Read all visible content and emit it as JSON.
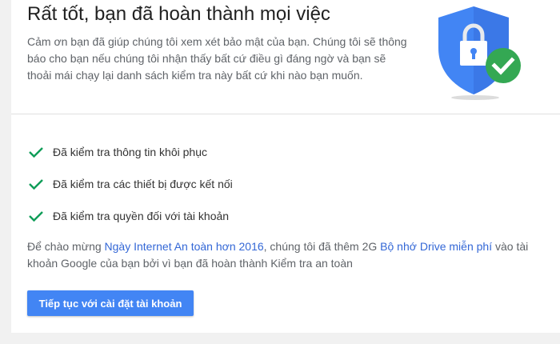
{
  "header": {
    "title": "Rất tốt, bạn đã hoàn thành mọi việc",
    "description": "Cảm ơn bạn đã giúp chúng tôi xem xét bảo mật của bạn. Chúng tôi sẽ thông báo cho bạn nếu chúng tôi nhận thấy bất cứ điều gì đáng ngờ và bạn sẽ thoải mái chạy lại danh sách kiểm tra này bất cứ khi nào bạn muốn."
  },
  "illustration": {
    "icon": "shield-lock-check-icon",
    "shield_color": "#4285f4",
    "check_color": "#34a853"
  },
  "checklist": [
    {
      "label": "Đã kiểm tra thông tin khôi phục",
      "icon": "checkmark-icon"
    },
    {
      "label": "Đã kiểm tra các thiết bị được kết nối",
      "icon": "checkmark-icon"
    },
    {
      "label": "Đã kiểm tra quyền đối với tài khoản",
      "icon": "checkmark-icon"
    }
  ],
  "promo": {
    "prefix": "Để chào mừng ",
    "event_link": "Ngày Internet An toàn hơn 2016",
    "middle": ", chúng tôi đã thêm 2G ",
    "storage_link": "Bộ nhớ Drive miễn phí",
    "suffix": " vào tài khoản Google của bạn bởi vì bạn đã hoàn thành Kiểm tra an toàn"
  },
  "actions": {
    "continue_label": "Tiếp tục với cài đặt tài khoản"
  },
  "colors": {
    "accent": "#4285f4",
    "check_green": "#0f9d58",
    "link": "#3367d6"
  }
}
